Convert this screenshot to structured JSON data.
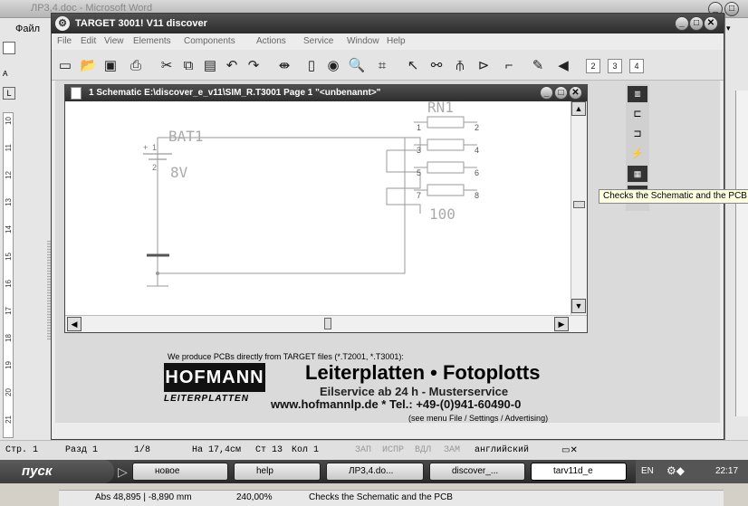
{
  "word": {
    "title": "ЛР3,4.doc - Microsoft Word",
    "menu_first": "Файл"
  },
  "target": {
    "title": "TARGET 3001! V11 discover",
    "menu": [
      "File",
      "Edit",
      "View",
      "Elements",
      "Components",
      "Actions",
      "Service",
      "Window",
      "Help"
    ],
    "schematic_title": "1 Schematic E:\\discover_e_v11\\SIM_R.T3001 Page 1 \"<unbenannt>\"",
    "tooltip": "Checks the Schematic and the PCB",
    "toolbar_small": [
      "2",
      "3",
      "4"
    ]
  },
  "schematic": {
    "bat_name": "BAT1",
    "bat_value": "8V",
    "bat_pins": [
      "1",
      "2"
    ],
    "rn_name": "RN1",
    "rn_value": "100",
    "rn_pins": [
      [
        "1",
        "2"
      ],
      [
        "3",
        "4"
      ],
      [
        "5",
        "6"
      ],
      [
        "7",
        "8"
      ]
    ],
    "plus": "+"
  },
  "ad": {
    "line1": "We produce PCBs directly from TARGET files (*.T2001, *.T3001):",
    "logo": "HOFMANN",
    "logo_sub": "LEITERPLATTEN",
    "headline": "Leiterplatten • Fotoplotts",
    "subline": "Eilservice ab 24 h - Musterservice",
    "web": "www.hofmannlp.de * Tel.: +49-(0)941-60490-0",
    "note": "(see menu File / Settings / Advertising)"
  },
  "status": {
    "coords": "Abs 48,895 | -8,890 mm",
    "zoom": "240,00%",
    "hint": "Checks the Schematic and the PCB"
  },
  "word_status": {
    "page": "Стр. 1",
    "section": "Разд 1",
    "pages": "1/8",
    "at": "На 17,4см",
    "line": "Ст 13",
    "col": "Кол 1",
    "flags": [
      "ЗАП",
      "ИСПР",
      "ВДЛ",
      "ЗАМ"
    ],
    "lang": "английский"
  },
  "taskbar": {
    "start": "пуск",
    "items": [
      "новое",
      "help",
      "ЛР3,4.do...",
      "discover_...",
      "tarv11d_e"
    ],
    "lang": "EN",
    "time": "22:17"
  },
  "ruler": [
    "10",
    "11",
    "12",
    "13",
    "14",
    "15",
    "16",
    "17",
    "18",
    "19",
    "20",
    "21"
  ]
}
